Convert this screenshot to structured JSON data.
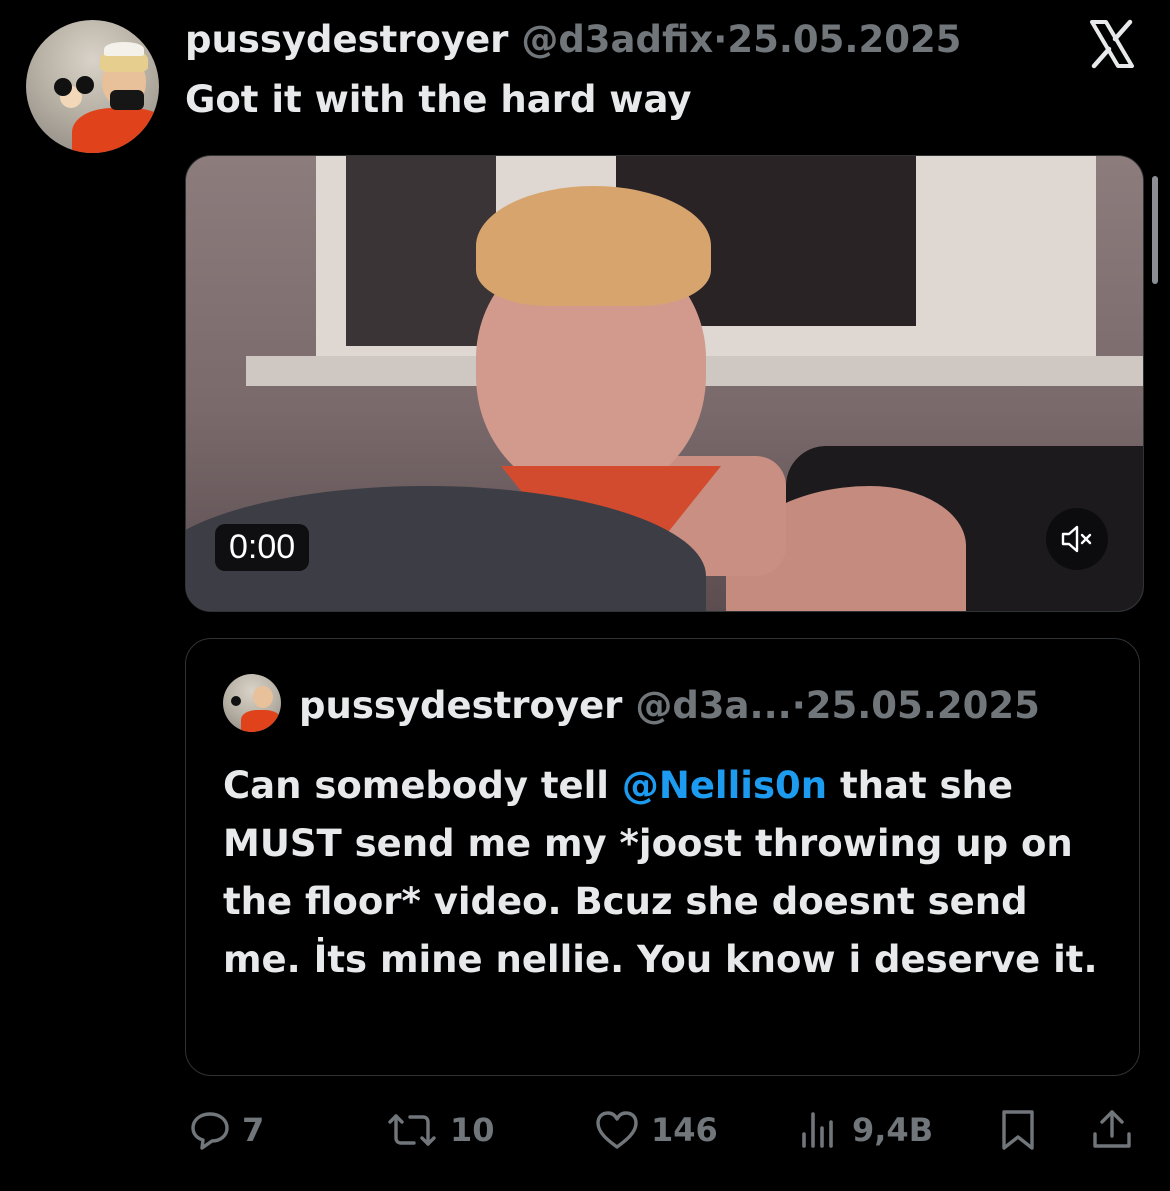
{
  "tweet": {
    "username": "pussydestroyer",
    "handle": "@d3adfix",
    "separator": "·",
    "date": "25.05.2025",
    "text": "Got it with the hard way"
  },
  "video": {
    "timer": "0:00",
    "muted": true
  },
  "quote": {
    "username": "pussydestroyer",
    "handle": "@d3a...",
    "separator": "·",
    "date": "25.05.2025",
    "text_before": "Can somebody tell ",
    "mention": "@Nellis0n",
    "text_after": " that she MUST send me my *joost throwing up on the floor* video. Bcuz she doesnt send me. İts mine nellie. You know i deserve it."
  },
  "actions": {
    "replies": "7",
    "reposts": "10",
    "likes": "146",
    "views": "9,4B"
  },
  "icons": {
    "logo": "x-logo-icon",
    "mute": "volume-muted-icon",
    "reply": "reply-icon",
    "repost": "repost-icon",
    "like": "heart-icon",
    "views": "views-icon",
    "bookmark": "bookmark-icon",
    "share": "share-icon"
  },
  "colors": {
    "background": "#000000",
    "text": "#e7e9ea",
    "muted": "#71767b",
    "link": "#1d9bf0"
  }
}
